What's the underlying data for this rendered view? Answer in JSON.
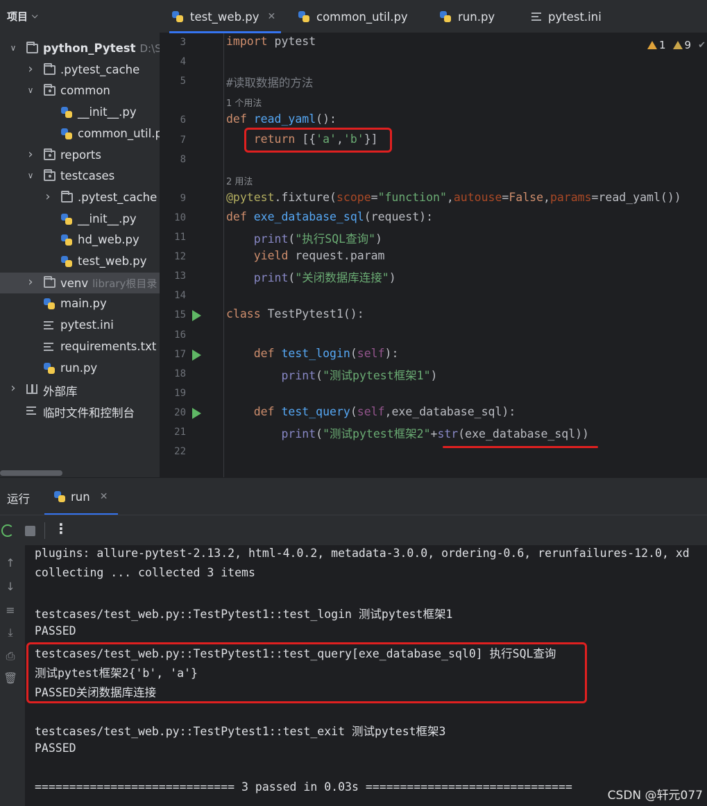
{
  "project_panel": {
    "title": "项目",
    "tree": [
      {
        "label": "python_Pytest",
        "suffix": "D:\\Sof",
        "icon": "folder-icon",
        "arrow": "expanded",
        "level": 0,
        "bold": true
      },
      {
        "label": ".pytest_cache",
        "icon": "folder-icon",
        "arrow": "collapsed",
        "level": 1
      },
      {
        "label": "common",
        "icon": "package-icon",
        "arrow": "expanded",
        "level": 1
      },
      {
        "label": "__init__.py",
        "icon": "python-file-icon",
        "level": 2
      },
      {
        "label": "common_util.py",
        "icon": "python-file-icon",
        "level": 2
      },
      {
        "label": "reports",
        "icon": "package-icon",
        "arrow": "collapsed",
        "level": 1
      },
      {
        "label": "testcases",
        "icon": "package-icon",
        "arrow": "expanded",
        "level": 1
      },
      {
        "label": ".pytest_cache",
        "icon": "folder-icon",
        "arrow": "collapsed",
        "level": 2
      },
      {
        "label": "__init__.py",
        "icon": "python-file-icon",
        "level": 2
      },
      {
        "label": "hd_web.py",
        "icon": "python-file-icon",
        "level": 2
      },
      {
        "label": "test_web.py",
        "icon": "python-file-icon",
        "level": 2
      },
      {
        "label": "venv",
        "suffix": "library根目录",
        "icon": "folder-icon",
        "arrow": "collapsed",
        "level": 1,
        "selected": true
      },
      {
        "label": "main.py",
        "icon": "python-file-icon",
        "level": 1
      },
      {
        "label": "pytest.ini",
        "icon": "text-file-icon",
        "level": 1
      },
      {
        "label": "requirements.txt",
        "icon": "text-file-icon",
        "level": 1
      },
      {
        "label": "run.py",
        "icon": "python-file-icon",
        "level": 1
      },
      {
        "label": "外部库",
        "icon": "library-icon",
        "arrow": "collapsed",
        "level": 0
      },
      {
        "label": "临时文件和控制台",
        "icon": "scratch-icon",
        "level": 0
      }
    ]
  },
  "editor_tabs": [
    {
      "label": "test_web.py",
      "icon": "python-file-icon",
      "active": true,
      "closable": true
    },
    {
      "label": "common_util.py",
      "icon": "python-file-icon"
    },
    {
      "label": "run.py",
      "icon": "python-file-icon"
    },
    {
      "label": "pytest.ini",
      "icon": "text-file-icon"
    }
  ],
  "inspections": {
    "warnings": "1",
    "weak_warnings": "9"
  },
  "code_lines": [
    {
      "ln": "3",
      "html": "<span class='kw'>import</span> pytest"
    },
    {
      "ln": "4",
      "html": ""
    },
    {
      "ln": "5",
      "html": "<span class='cm'>#读取数据的方法</span>"
    },
    {
      "hint": "1 个用法"
    },
    {
      "ln": "6",
      "html": "<span class='kw'>def</span> <span class='fn'>read_yaml</span>():"
    },
    {
      "ln": "7",
      "html": "    <span class='kw'>return</span> [{<span class='str'>'a'</span>,<span class='str'>'b'</span>}]"
    },
    {
      "ln": "8",
      "html": ""
    },
    {
      "hint": "2 用法"
    },
    {
      "ln": "9",
      "html": "<span class='deco'>@pytest</span>.fixture(<span class='par'>scope</span>=<span class='str'>\"function\"</span>,<span class='par'>autouse</span>=<span class='kw'>False</span>,<span class='par'>params</span>=read_yaml())"
    },
    {
      "ln": "10",
      "html": "<span class='kw'>def</span> <span class='fn'>exe_database_sql</span>(request):"
    },
    {
      "ln": "11",
      "html": "    <span class='bi'>print</span>(<span class='str'>\"执行SQL查询\"</span>)"
    },
    {
      "ln": "12",
      "html": "    <span class='kw'>yield</span> request.param"
    },
    {
      "ln": "13",
      "html": "    <span class='bi'>print</span>(<span class='str'>\"关闭数据库连接\"</span>)"
    },
    {
      "ln": "14",
      "html": ""
    },
    {
      "ln": "15",
      "run": true,
      "html": "<span class='kw'>class</span> TestPytest1():"
    },
    {
      "ln": "16",
      "html": ""
    },
    {
      "ln": "17",
      "run": true,
      "html": "    <span class='kw'>def</span> <span class='fn'>test_login</span>(<span class='slf'>self</span>):"
    },
    {
      "ln": "18",
      "html": "        <span class='bi'>print</span>(<span class='str'>\"测试pytest框架1\"</span>)"
    },
    {
      "ln": "19",
      "html": ""
    },
    {
      "ln": "20",
      "run": true,
      "html": "    <span class='kw'>def</span> <span class='fn'>test_query</span>(<span class='slf'>self</span>,exe_database_sql):"
    },
    {
      "ln": "21",
      "html": "        <span class='bi'>print</span>(<span class='str'>\"测试pytest框架2\"</span>+<span class='bi'>str</span>(exe_database_sql))"
    },
    {
      "ln": "22",
      "html": ""
    }
  ],
  "run_panel": {
    "title": "运行",
    "tab_label": "run",
    "console_lines": [
      "plugins: allure-pytest-2.13.2, html-4.0.2, metadata-3.0.0, ordering-0.6, rerunfailures-12.0, xd",
      "collecting ... collected 3 items",
      "",
      "testcases/test_web.py::TestPytest1::test_login 测试pytest框架1",
      "PASSED",
      "testcases/test_web.py::TestPytest1::test_query[exe_database_sql0] 执行SQL查询",
      "测试pytest框架2{'b', 'a'}",
      "PASSED关闭数据库连接",
      "",
      "testcases/test_web.py::TestPytest1::test_exit 测试pytest框架3",
      "PASSED",
      "",
      "============================= 3 passed in 0.03s =============================="
    ]
  },
  "watermark": "CSDN @轩元077",
  "colors": {
    "annotation_red": "#e02020",
    "accent_blue": "#3574f0",
    "run_green": "#5fb865"
  }
}
